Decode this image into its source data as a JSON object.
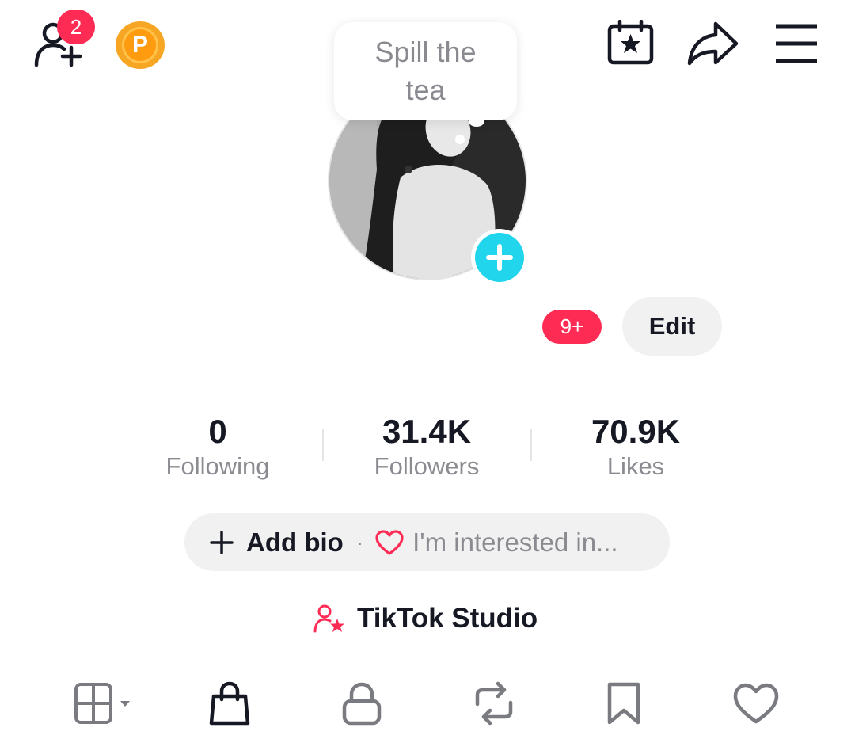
{
  "header": {
    "add_friends_badge": "2",
    "coin_letter": "P"
  },
  "bubble": {
    "text": "Spill the tea"
  },
  "profile": {
    "notifications_badge": "9+",
    "edit_label": "Edit"
  },
  "stats": [
    {
      "value": "0",
      "label": "Following"
    },
    {
      "value": "31.4K",
      "label": "Followers"
    },
    {
      "value": "70.9K",
      "label": "Likes"
    }
  ],
  "bio": {
    "add_label": "Add bio",
    "separator": "·",
    "interests_label": "I'm interested in..."
  },
  "studio": {
    "label": "TikTok Studio"
  },
  "tabs": [
    "grid-icon",
    "shopping-bag-icon",
    "lock-icon",
    "repost-icon",
    "bookmark-icon",
    "heart-icon"
  ],
  "colors": {
    "accent": "#fe2c55",
    "cyan": "#20d5ec",
    "coin": "#ff9b0e",
    "text": "#161823",
    "muted": "#8a8b91",
    "pill": "#f1f1f2"
  }
}
